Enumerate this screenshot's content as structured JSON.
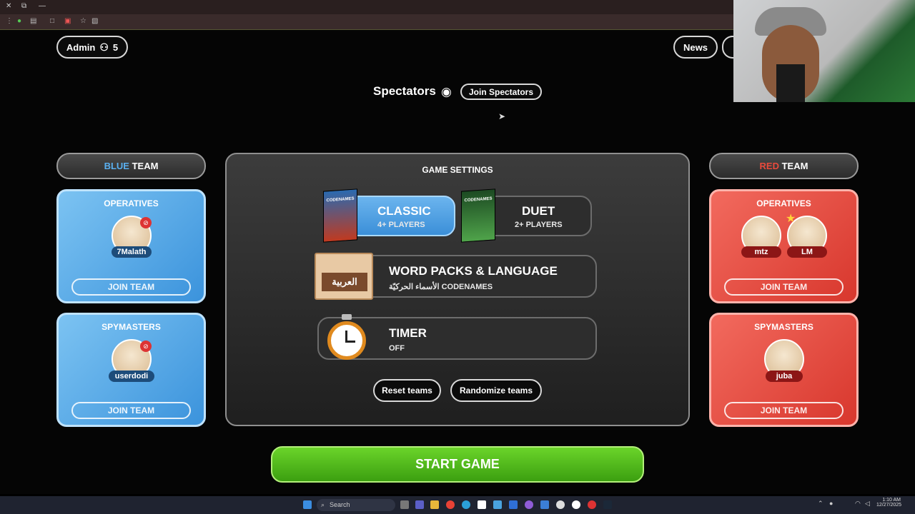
{
  "header": {
    "admin_label": "Admin",
    "player_count": "5",
    "news_label": "News"
  },
  "spectators": {
    "title": "Spectators",
    "join_label": "Join Spectators"
  },
  "blue_team": {
    "header_colored": "BLUE",
    "header_rest": " TEAM",
    "operatives": {
      "title": "OPERATIVES",
      "players": [
        "7Malath"
      ],
      "join_label": "JOIN TEAM"
    },
    "spymasters": {
      "title": "SPYMASTERS",
      "players": [
        "userdodi"
      ],
      "join_label": "JOIN TEAM"
    }
  },
  "red_team": {
    "header_colored": "RED",
    "header_rest": " TEAM",
    "operatives": {
      "title": "OPERATIVES",
      "players": [
        "mtz",
        "LM"
      ],
      "join_label": "JOIN TEAM"
    },
    "spymasters": {
      "title": "SPYMASTERS",
      "players": [
        "juba"
      ],
      "join_label": "JOIN TEAM"
    }
  },
  "settings": {
    "title": "GAME SETTINGS",
    "classic": {
      "title": "CLASSIC",
      "sub": "4+ PLAYERS",
      "box_label": "CODENAMES"
    },
    "duet": {
      "title": "DUET",
      "sub": "2+ PLAYERS",
      "box_label": "CODENAMES"
    },
    "word_packs": {
      "title": "WORD PACKS & LANGUAGE",
      "sub": "الأسماء الحركيّة CODENAMES",
      "badge": "العربية"
    },
    "timer": {
      "title": "TIMER",
      "sub": "OFF"
    },
    "reset_label": "Reset teams",
    "randomize_label": "Randomize teams"
  },
  "start_label": "START GAME",
  "taskbar": {
    "search_placeholder": "Search",
    "time": "1:10 AM",
    "date": "12/27/2025"
  },
  "colors": {
    "blue_accent": "#5ab0f0",
    "red_accent": "#e84a3c",
    "start_green": "#4db81a"
  }
}
